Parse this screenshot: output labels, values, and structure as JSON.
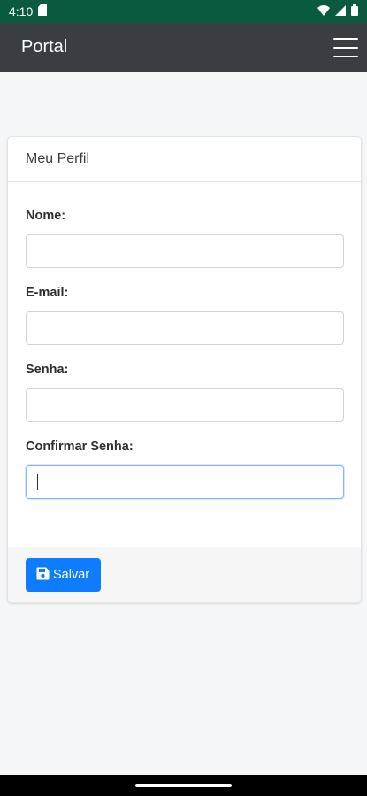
{
  "status_bar": {
    "time": "4:10",
    "icons": [
      "sd-card-icon",
      "wifi-icon",
      "signal-icon",
      "battery-icon"
    ]
  },
  "app_bar": {
    "title": "Portal",
    "menu_icon": "hamburger-menu-icon"
  },
  "card": {
    "title": "Meu Perfil",
    "fields": [
      {
        "label": "Nome:",
        "value": "",
        "focused": false
      },
      {
        "label": "E-mail:",
        "value": "",
        "focused": false
      },
      {
        "label": "Senha:",
        "value": "",
        "focused": false
      },
      {
        "label": "Confirmar Senha:",
        "value": "",
        "focused": true
      }
    ],
    "save_button": {
      "label": "Salvar",
      "icon": "floppy-disk-icon"
    }
  },
  "colors": {
    "status_bar": "#0a5a3f",
    "app_bar": "#3a3d42",
    "primary": "#0d7cff",
    "page_background": "#f5f6f8",
    "focus_border": "#86b7fe"
  }
}
